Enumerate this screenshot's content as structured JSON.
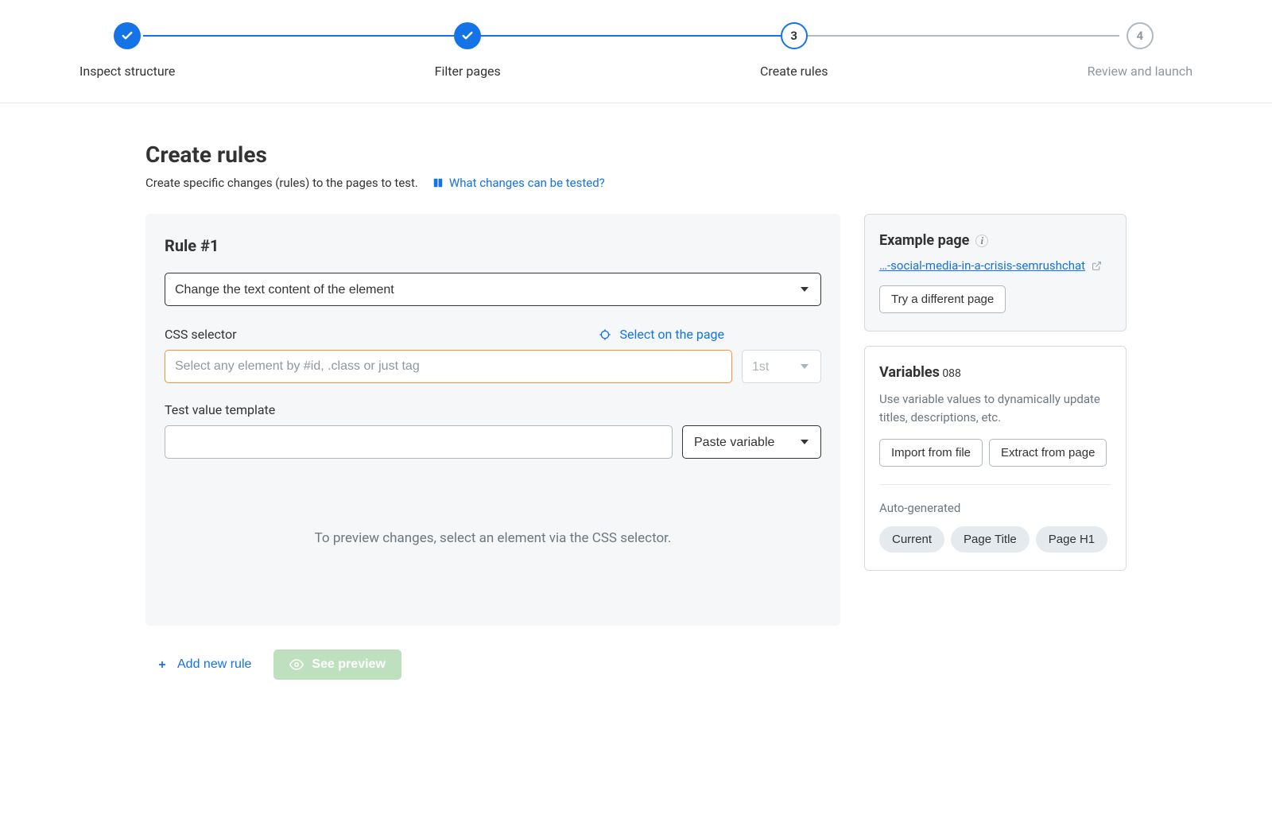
{
  "stepper": {
    "steps": [
      {
        "label": "Inspect structure",
        "state": "done"
      },
      {
        "label": "Filter pages",
        "state": "done"
      },
      {
        "label": "Create rules",
        "state": "current",
        "num": "3"
      },
      {
        "label": "Review and launch",
        "state": "future",
        "num": "4"
      }
    ]
  },
  "page": {
    "title": "Create rules",
    "subtitle": "Create specific changes (rules) to the pages to test.",
    "help_link": "What changes can be tested?"
  },
  "rule": {
    "title": "Rule #1",
    "action_select": "Change the text content of the element",
    "css_label": "CSS selector",
    "select_on_page": "Select on the page",
    "css_placeholder": "Select any element by #id, .class or just tag",
    "css_value": "",
    "nth_select": "1st",
    "template_label": "Test value template",
    "template_value": "",
    "paste_variable_label": "Paste variable",
    "preview_hint": "To preview changes, select an element via the CSS selector."
  },
  "actions": {
    "add_rule": "Add new rule",
    "see_preview": "See preview"
  },
  "example_page": {
    "title": "Example page",
    "url": "…-social-media-in-a-crisis-semrushchat",
    "try_button": "Try a different page"
  },
  "variables": {
    "title": "Variables",
    "desc": "Use variable values to dynamically update titles, descriptions, etc.",
    "import_btn": "Import from file",
    "extract_btn": "Extract from page",
    "auto_label": "Auto-generated",
    "pills": [
      "Current",
      "Page Title",
      "Page H1"
    ]
  }
}
